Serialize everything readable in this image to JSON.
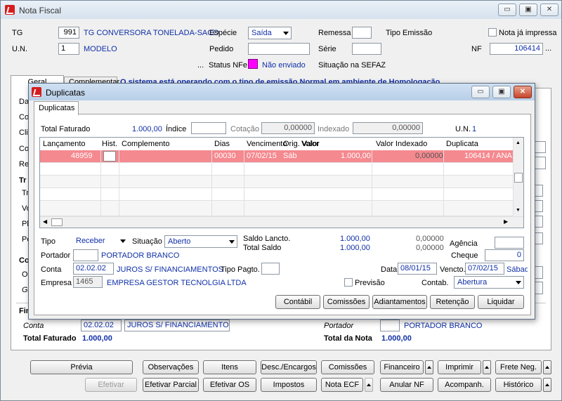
{
  "window": {
    "title": "Nota Fiscal"
  },
  "header": {
    "tg_label": "TG",
    "tg_code": "991",
    "tg_name": "TG CONVERSORA TONELADA-SACO",
    "un_label": "U.N.",
    "un_code": "1",
    "un_name": "MODELO",
    "especie_label": "Espécie",
    "especie_value": "Saída",
    "pedido_label": "Pedido",
    "remessa_label": "Remessa",
    "tipo_emissao_label": "Tipo Emissão",
    "serie_label": "Série",
    "nota_impressa_label": "Nota já impressa",
    "nf_label": "NF",
    "nf_value": "106414",
    "nf_dots": "...",
    "status_dots": "...",
    "status_label": "Status NFe",
    "status_value": "Não enviado",
    "situacao_label": "Situação na SEFAZ"
  },
  "tabs": {
    "geral": "Geral",
    "complementar": "Complementar",
    "homolog_msg": "O sistema está operando com o tipo de emissão Normal em ambiente de Homologação"
  },
  "left_labels": [
    "Dat",
    "Con",
    "Clie",
    "Cob",
    "Rep",
    "Tr",
    "Tra",
    "Vol",
    "Pla",
    "Pes",
    "Co",
    "Ori",
    "Gr",
    "Fin"
  ],
  "footer": {
    "conta_label": "Conta",
    "conta_code": "02.02.02",
    "conta_name": "JUROS S/ FINANCIAMENTOS",
    "portador_label": "Portador",
    "portador_name": "PORTADOR BRANCO",
    "total_faturado_label": "Total Faturado",
    "total_faturado_value": "1.000,00",
    "total_nota_label": "Total da Nota",
    "total_nota_value": "1.000,00"
  },
  "buttons": {
    "previa": "Prévia",
    "observacoes": "Observações",
    "itens": "Itens",
    "desc_encargos": "Desc./Encargos",
    "comissoes": "Comissões",
    "financeiro": "Financeiro",
    "imprimir": "Imprimir",
    "frete_neg": "Frete Neg.",
    "efetivar": "Efetivar",
    "efetivar_parcial": "Efetivar Parcial",
    "efetivar_os": "Efetivar OS",
    "impostos": "Impostos",
    "nota_ecf": "Nota ECF",
    "anular_nf": "Anular NF",
    "acompanh": "Acompanh.",
    "historico": "Histórico"
  },
  "dialog": {
    "title": "Duplicatas",
    "tab": "Duplicatas",
    "total_faturado_label": "Total Faturado",
    "total_faturado_value": "1.000,00",
    "indice_label": "Índice",
    "cotacao_label": "Cotação",
    "cotacao_value": "0,00000",
    "indexado_label": "Indexado",
    "indexado_value": "0,00000",
    "un_label": "U.N.",
    "un_value": "1",
    "columns": [
      "Lançamento",
      "Hist.",
      "Complemento",
      "Dias",
      "Vencimento",
      "Orig. Valor",
      "Valor",
      "Valor Indexado",
      "Duplicata"
    ],
    "row": {
      "lancamento": "48959",
      "hist": "",
      "complemento": "",
      "dias": "00030",
      "vencimento": "07/02/15",
      "dia_semana": "Sáb",
      "valor": "1.000,00",
      "valor_indexado": "0,00000",
      "duplicata": "106414 / ANA1"
    },
    "tipo_label": "Tipo",
    "tipo_value": "Receber",
    "situacao_label": "Situação",
    "situacao_value": "Aberto",
    "saldo_lancto_label": "Saldo Lancto.",
    "saldo_lancto_value": "1.000,00",
    "saldo_lancto_idx": "0,00000",
    "total_saldo_label": "Total Saldo",
    "total_saldo_value": "1.000,00",
    "total_saldo_idx": "0,00000",
    "agencia_label": "Agência",
    "cheque_label": "Cheque",
    "cheque_value": "0",
    "portador_label": "Portador",
    "portador_name": "PORTADOR BRANCO",
    "conta_label": "Conta",
    "conta_code": "02.02.02",
    "conta_name": "JUROS S/ FINANCIAMENTOS",
    "tipo_pagto_label": "Tipo Pagto.",
    "data_label": "Data",
    "data_value": "08/01/15",
    "vencto_label": "Vencto.",
    "vencto_value": "07/02/15",
    "vencto_dia": "Sábad",
    "empresa_label": "Empresa",
    "empresa_code": "1465",
    "empresa_name": "EMPRESA GESTOR TECNOLGIA LTDA",
    "previsao_label": "Previsão",
    "contab_label": "Contab.",
    "contab_value": "Abertura",
    "btn_contabil": "Contábil",
    "btn_comissoes": "Comissões",
    "btn_adiantamentos": "Adiantamentos",
    "btn_retencao": "Retenção",
    "btn_liquidar": "Liquidar"
  }
}
